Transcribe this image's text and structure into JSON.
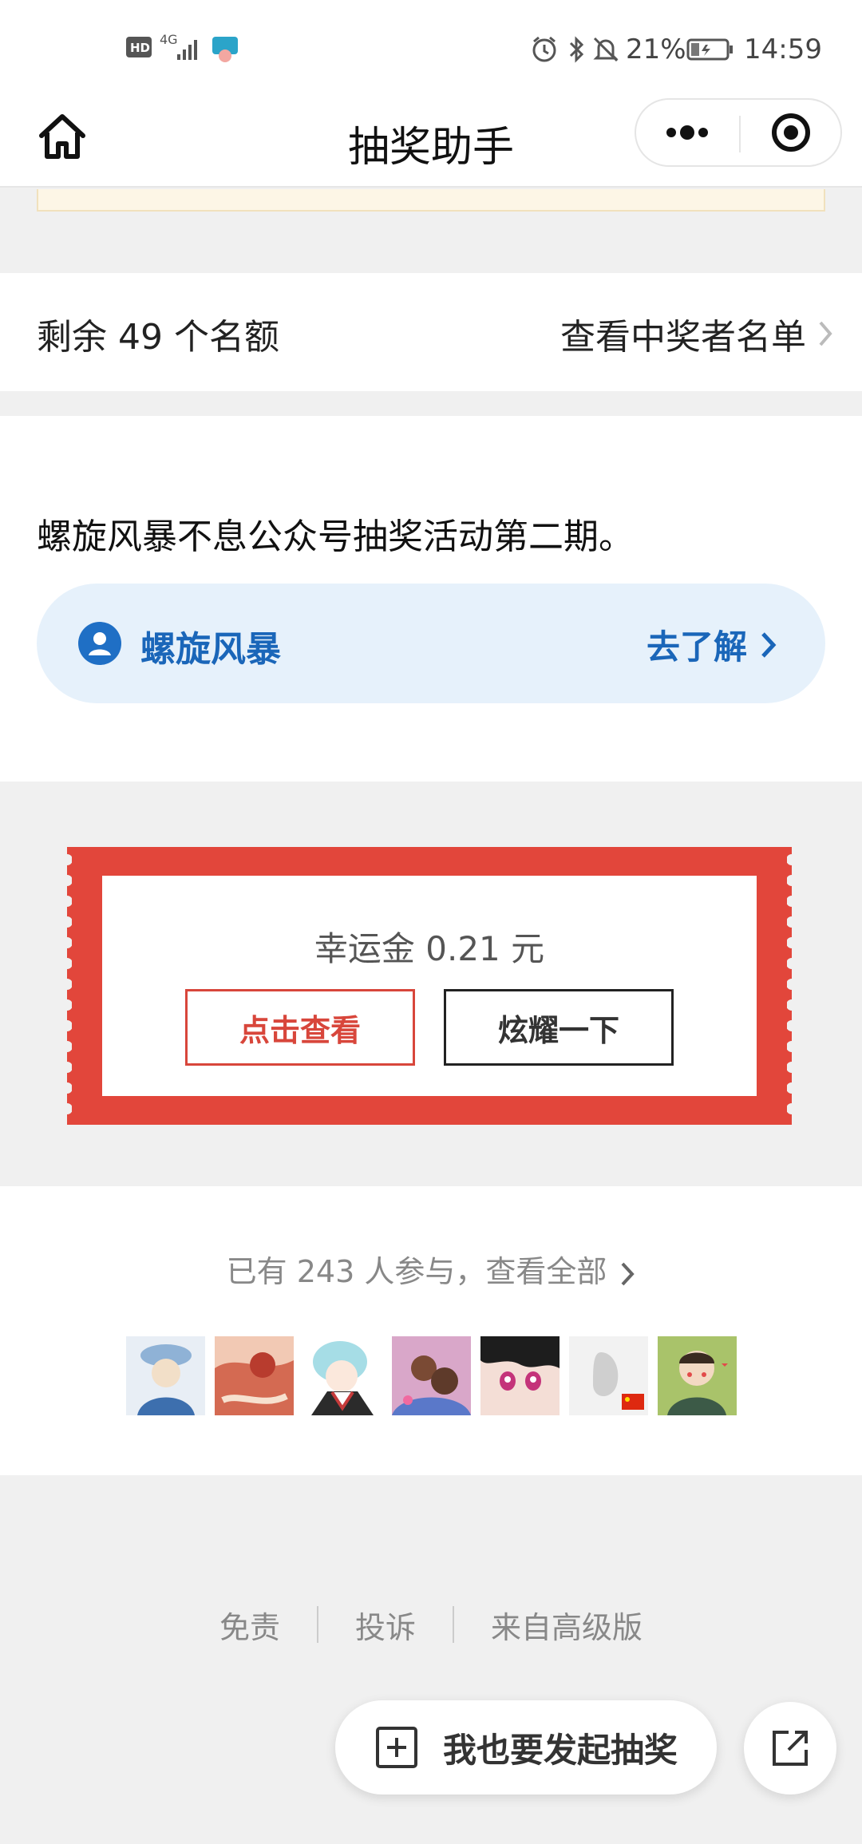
{
  "status_bar": {
    "network_label": "4G",
    "battery_percent": "21%",
    "time": "14:59",
    "icons": [
      "hd-icon",
      "signal-icon",
      "app-notification-icon",
      "alarm-icon",
      "bluetooth-icon",
      "mute-icon",
      "battery-icon"
    ]
  },
  "nav": {
    "title": "抽奖助手"
  },
  "quota": {
    "remaining_text": "剩余 49 个名额",
    "winners_link": "查看中奖者名单"
  },
  "description": {
    "text": "螺旋风暴不息公众号抽奖活动第二期。",
    "account_name": "螺旋风暴",
    "learn_more": "去了解"
  },
  "ticket": {
    "lucky_money": "幸运金 0.21 元",
    "view_button": "点击查看",
    "show_off_button": "炫耀一下",
    "colors": {
      "ticket_red": "#e2463b",
      "link_blue": "#1a66b9"
    }
  },
  "participants": {
    "link_text": "已有 243 人参与，查看全部",
    "avatars": [
      "avatar-1",
      "avatar-2",
      "avatar-3",
      "avatar-4",
      "avatar-5",
      "avatar-6",
      "avatar-7"
    ]
  },
  "footer": {
    "disclaimer": "免责",
    "complaint": "投诉",
    "from_advanced": "来自高级版"
  },
  "actions": {
    "start_lottery": "我也要发起抽奖"
  }
}
